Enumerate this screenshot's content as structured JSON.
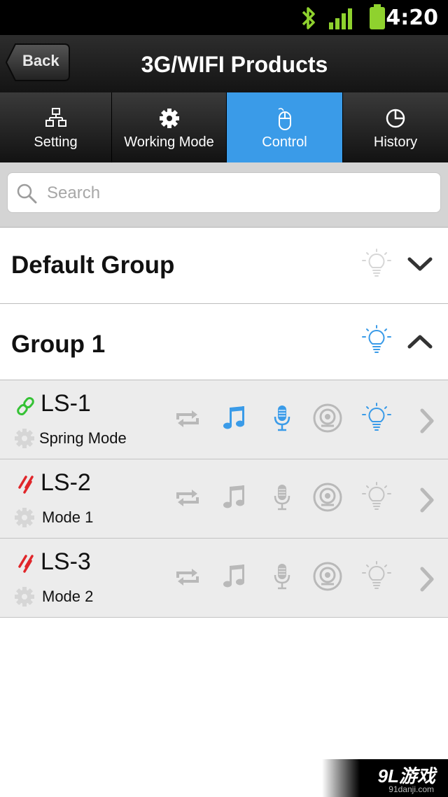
{
  "status_bar": {
    "time": "4:20"
  },
  "header": {
    "back_label": "Back",
    "title": "3G/WIFI Products"
  },
  "tabs": [
    {
      "label": "Setting",
      "icon": "network-icon",
      "active": false
    },
    {
      "label": "Working Mode",
      "icon": "gear-icon",
      "active": false
    },
    {
      "label": "Control",
      "icon": "mouse-icon",
      "active": true
    },
    {
      "label": "History",
      "icon": "pie-chart-icon",
      "active": false
    }
  ],
  "search": {
    "placeholder": "Search"
  },
  "groups": [
    {
      "name": "Default Group",
      "expanded": false,
      "light_on": false
    },
    {
      "name": "Group 1",
      "expanded": true,
      "light_on": true
    }
  ],
  "devices": [
    {
      "name": "LS-1",
      "mode": "Spring Mode",
      "connected": true,
      "music_on": true,
      "mic_on": true,
      "light_on": true
    },
    {
      "name": "LS-2",
      "mode": "Mode 1",
      "connected": false,
      "music_on": false,
      "mic_on": false,
      "light_on": false
    },
    {
      "name": "LS-3",
      "mode": "Mode 2",
      "connected": false,
      "music_on": false,
      "mic_on": false,
      "light_on": false
    }
  ],
  "colors": {
    "accent": "#3a9be8",
    "connected": "#35c235",
    "disconnected": "#e0262a",
    "inactive_icon": "#b9b9b9"
  },
  "watermark": {
    "brand": "9L游戏",
    "site": "91danji.com"
  }
}
